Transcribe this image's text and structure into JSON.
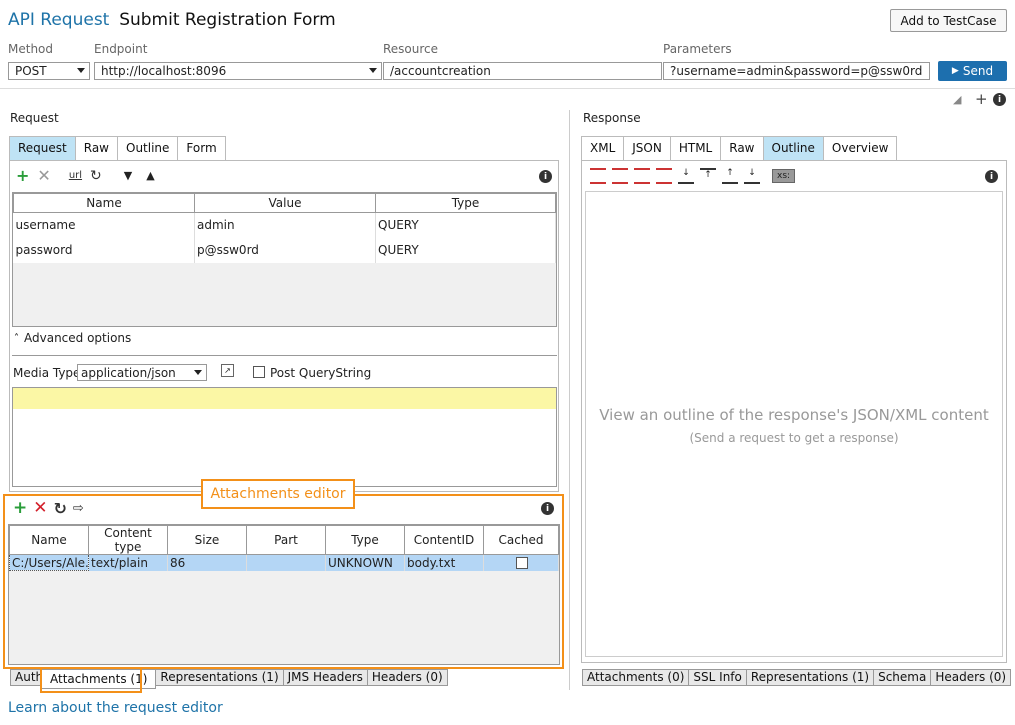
{
  "header": {
    "api_label": "API Request",
    "title": "Submit Registration Form",
    "add_button": "Add to TestCase"
  },
  "request_line": {
    "method_label": "Method",
    "method_value": "POST",
    "endpoint_label": "Endpoint",
    "endpoint_value": "http://localhost:8096",
    "resource_label": "Resource",
    "resource_value": "/accountcreation",
    "parameters_label": "Parameters",
    "parameters_value": "?username=admin&password=p@ssw0rd",
    "send_label": "Send"
  },
  "request_panel": {
    "title": "Request",
    "tabs": [
      "Request",
      "Raw",
      "Outline",
      "Form"
    ],
    "active_tab": "Request",
    "columns": [
      "Name",
      "Value",
      "Type"
    ],
    "rows": [
      {
        "name": "username",
        "value": "admin",
        "type": "QUERY"
      },
      {
        "name": "password",
        "value": "p@ssw0rd",
        "type": "QUERY"
      }
    ],
    "advanced_options": "Advanced options",
    "media_type_label": "Media Type",
    "media_type_value": "application/json",
    "post_querystring_label": "Post QueryString"
  },
  "attachments": {
    "callout": "Attachments editor",
    "columns": [
      "Name",
      "Content type",
      "Size",
      "Part",
      "Type",
      "ContentID",
      "Cached"
    ],
    "rows": [
      {
        "name": "C:/Users/Ale...",
        "content_type": "text/plain",
        "size": "86",
        "part": "",
        "type": "UNKNOWN",
        "content_id": "body.txt",
        "cached": false
      }
    ]
  },
  "request_bottom_tabs": [
    "Auth",
    "Attachments (1)",
    "Representations (1)",
    "JMS Headers",
    "Headers (0)"
  ],
  "request_bottom_selected": "Attachments (1)",
  "response_panel": {
    "title": "Response",
    "tabs": [
      "XML",
      "JSON",
      "HTML",
      "Raw",
      "Outline",
      "Overview"
    ],
    "active_tab": "Outline",
    "xs_label": "xs:",
    "empty_title": "View an outline of the response's JSON/XML content",
    "empty_sub": "(Send a request to get a response)"
  },
  "response_bottom_tabs": [
    "Attachments (0)",
    "SSL Info",
    "Representations (1)",
    "Schema",
    "Headers (0)"
  ],
  "footer_link": "Learn about the request editor",
  "colors": {
    "accent": "#1e73a8",
    "tab_active": "#bfe3f5",
    "highlight": "#f39019",
    "row_selected": "#b4d6f5"
  }
}
